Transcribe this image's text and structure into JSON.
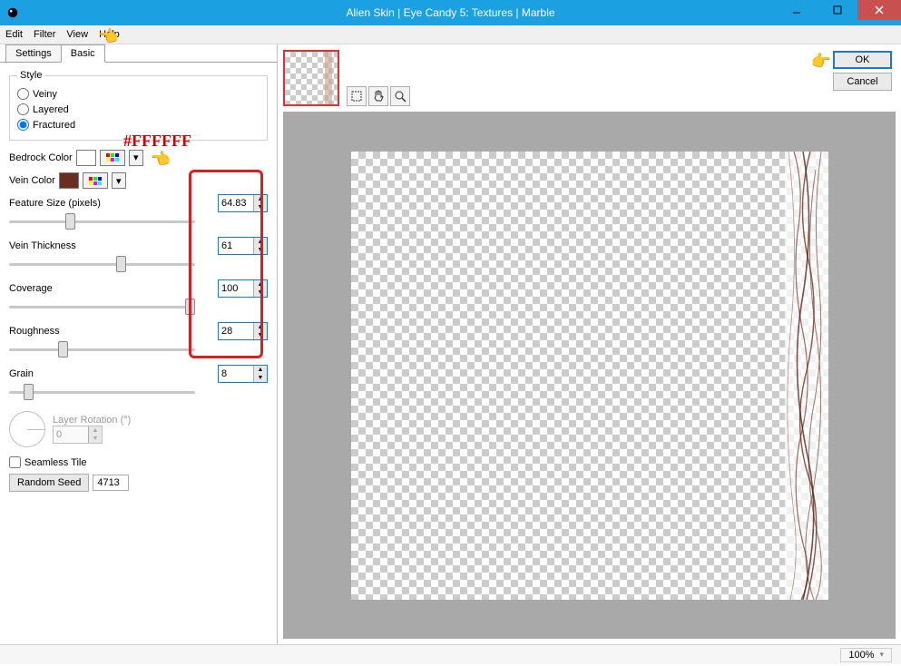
{
  "title": "Alien Skin | Eye Candy 5: Textures | Marble",
  "menu": {
    "edit": "Edit",
    "filter": "Filter",
    "view": "View",
    "help": "Help"
  },
  "tabs": {
    "settings": "Settings",
    "basic": "Basic"
  },
  "style": {
    "legend": "Style",
    "veiny": "Veiny",
    "layered": "Layered",
    "fractured": "Fractured",
    "selected": "Fractured"
  },
  "bedrock": {
    "label": "Bedrock Color",
    "hex": "#FFFFFF"
  },
  "vein": {
    "label": "Vein Color",
    "hex": "#6B2E1E"
  },
  "sliders": {
    "featureSize": {
      "label": "Feature Size (pixels)",
      "value": "64.83",
      "min": "1",
      "max": "200"
    },
    "veinThickness": {
      "label": "Vein Thickness",
      "value": "61",
      "min": "0",
      "max": "100"
    },
    "coverage": {
      "label": "Coverage",
      "value": "100",
      "min": "0",
      "max": "100"
    },
    "roughness": {
      "label": "Roughness",
      "value": "28",
      "min": "0",
      "max": "100"
    },
    "grain": {
      "label": "Grain",
      "value": "8",
      "min": "0",
      "max": "100"
    }
  },
  "rotation": {
    "label": "Layer Rotation (°)",
    "value": "0"
  },
  "seamless": {
    "label": "Seamless Tile",
    "checked": false
  },
  "seed": {
    "button": "Random Seed",
    "value": "4713"
  },
  "buttons": {
    "ok": "OK",
    "cancel": "Cancel"
  },
  "zoom": "100%",
  "annotation_hex": "#FFFFFF"
}
